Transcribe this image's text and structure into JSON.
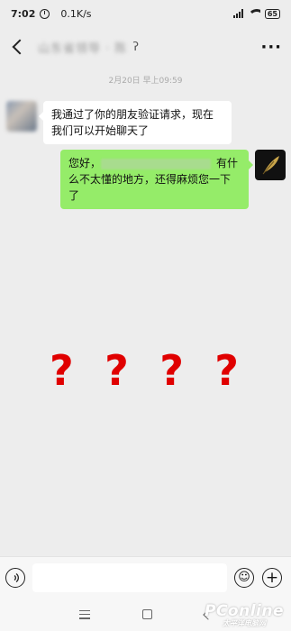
{
  "status_bar": {
    "time": "7:02",
    "speed": "0.1K/s",
    "battery": "65"
  },
  "header": {
    "contact_name": "山东省领导 · 陈",
    "more": "···"
  },
  "timestamp": "2月20日 早上09:59",
  "messages": [
    {
      "side": "left",
      "text": "我通过了你的朋友验证请求，现在我们可以开始聊天了"
    },
    {
      "side": "right",
      "text_before": "您好，",
      "text_after_1": "有什",
      "text_after_2": "么不太懂的地方，还得麻烦您一下了"
    }
  ],
  "overlay": {
    "marks": [
      "?",
      "?",
      "?",
      "?"
    ],
    "color": "#e00000"
  },
  "input_bar": {
    "value": "",
    "placeholder": ""
  },
  "watermark": {
    "main": "PConline",
    "sub": "太平洋电脑网"
  },
  "colors": {
    "sent_bubble": "#95ec69",
    "received_bubble": "#ffffff",
    "background": "#ededed"
  }
}
